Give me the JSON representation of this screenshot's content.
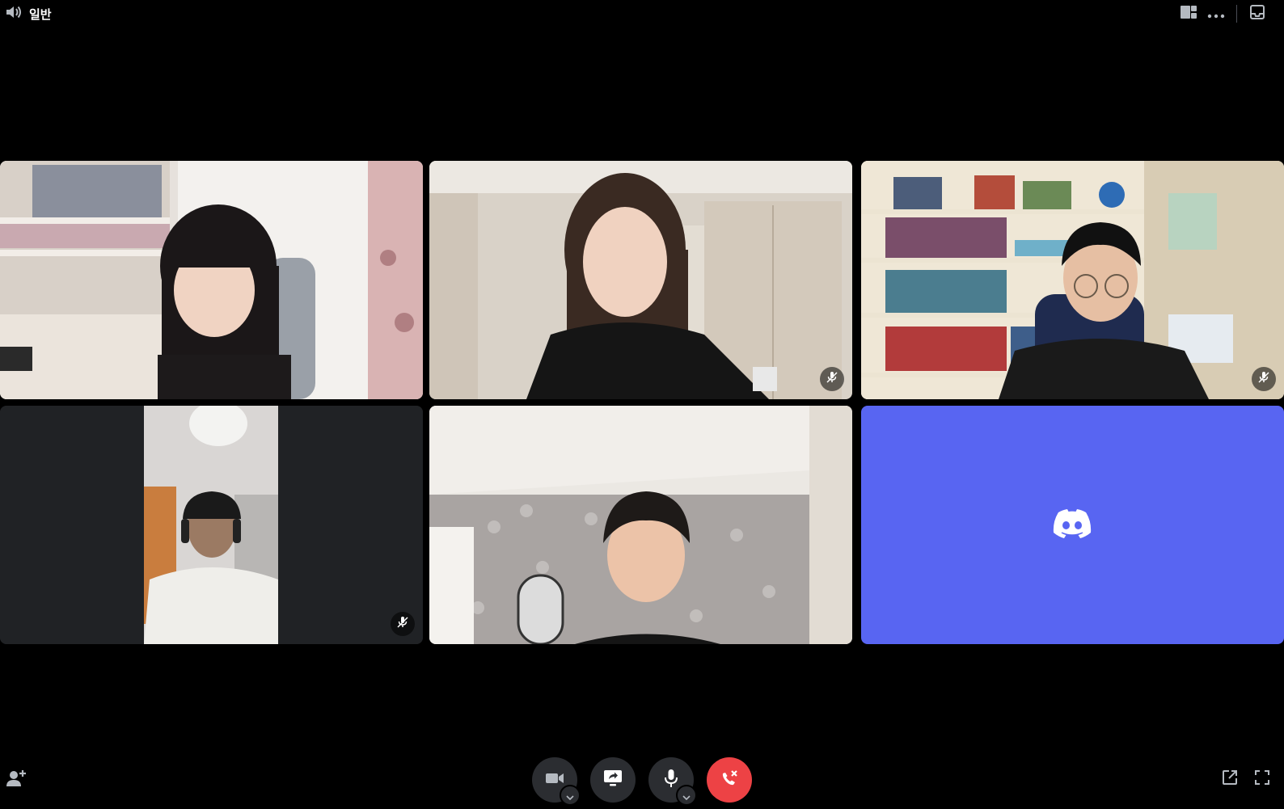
{
  "header": {
    "channel_name": "일반",
    "icons": [
      "speaker-icon",
      "grid-layout-icon",
      "more-icon",
      "inbox-icon"
    ]
  },
  "participants": [
    {
      "tile": 1,
      "muted": false
    },
    {
      "tile": 2,
      "muted": true
    },
    {
      "tile": 3,
      "muted": true
    },
    {
      "tile": 4,
      "muted": true
    },
    {
      "tile": 5,
      "muted": false
    },
    {
      "tile": 6,
      "muted": false,
      "avatar": "discord-logo-icon"
    }
  ],
  "colors": {
    "background": "#000000",
    "tile_bg": "#202225",
    "discord_blurple": "#5865f2",
    "control_bg": "#2b2d31",
    "hangup_red": "#ed4245"
  },
  "controls": {
    "icons": [
      "camera-icon",
      "screen-share-icon",
      "microphone-icon",
      "hangup-icon"
    ]
  },
  "footer": {
    "left_icon": "add-user-icon",
    "right_icons": [
      "pop-out-icon",
      "fullscreen-icon"
    ]
  }
}
